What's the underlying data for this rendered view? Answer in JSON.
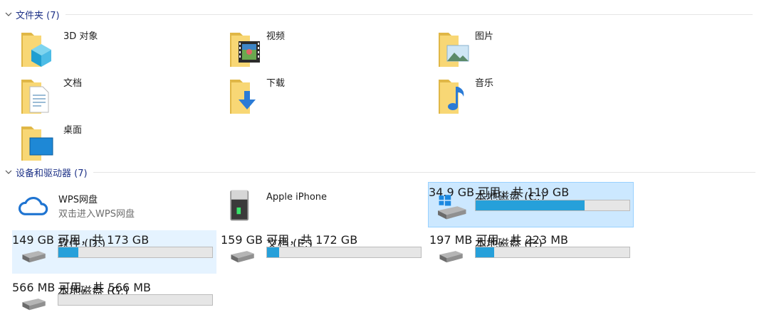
{
  "folders_group": {
    "title": "文件夹 (7)",
    "items": [
      {
        "label": "3D 对象",
        "icon": "3d-objects-folder-icon"
      },
      {
        "label": "视频",
        "icon": "videos-folder-icon"
      },
      {
        "label": "图片",
        "icon": "pictures-folder-icon"
      },
      {
        "label": "文档",
        "icon": "documents-folder-icon"
      },
      {
        "label": "下载",
        "icon": "downloads-folder-icon"
      },
      {
        "label": "音乐",
        "icon": "music-folder-icon"
      },
      {
        "label": "桌面",
        "icon": "desktop-folder-icon"
      }
    ]
  },
  "devices_group": {
    "title": "设备和驱动器 (7)",
    "wps": {
      "label": "WPS网盘",
      "sub": "双击进入WPS网盘",
      "icon": "cloud-icon"
    },
    "iphone": {
      "label": "Apple iPhone",
      "icon": "portable-device-icon"
    },
    "drives": [
      {
        "label": "本地磁盘 (C:)",
        "space": "34.9 GB 可用，共 119 GB",
        "used_fraction": 0.71,
        "icon": "windows-drive-icon"
      },
      {
        "label": "软件 (D:)",
        "space": "149 GB 可用，共 173 GB",
        "used_fraction": 0.13,
        "icon": "hard-drive-icon"
      },
      {
        "label": "文档 (E:)",
        "space": "159 GB 可用，共 172 GB",
        "used_fraction": 0.08,
        "icon": "hard-drive-icon"
      },
      {
        "label": "本地磁盘 (F:)",
        "space": "197 MB 可用，共 223 MB",
        "used_fraction": 0.12,
        "icon": "hard-drive-icon"
      },
      {
        "label": "本地磁盘 (G:)",
        "space": "566 MB 可用，共 566 MB",
        "used_fraction": 0.0,
        "icon": "hard-drive-icon"
      }
    ]
  },
  "colors": {
    "accent": "#26a0da",
    "selection": "#cce8ff",
    "header_text": "#1e3287"
  }
}
